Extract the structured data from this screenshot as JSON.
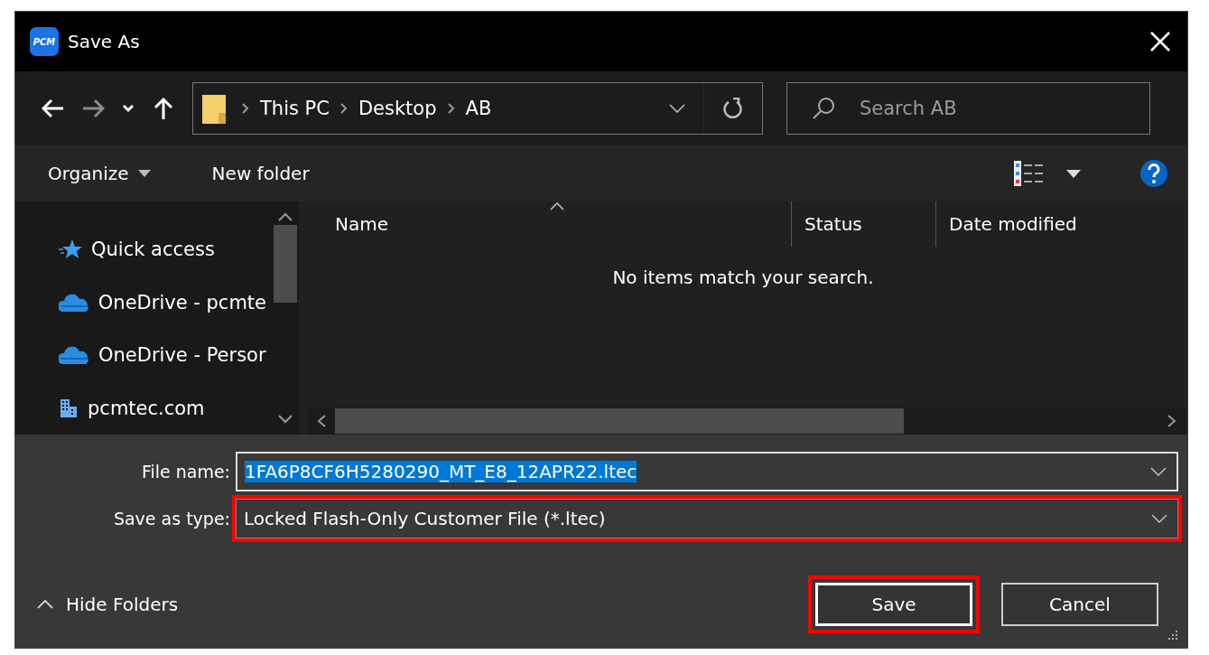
{
  "window": {
    "title": "Save As",
    "app_icon_label": "PCM"
  },
  "nav_buttons": [
    {
      "kind": "back",
      "disabled": false
    },
    {
      "kind": "forward",
      "disabled": true
    },
    {
      "kind": "recent",
      "disabled": false
    },
    {
      "kind": "up",
      "disabled": false
    }
  ],
  "address": {
    "segments": [
      "This PC",
      "Desktop",
      "AB"
    ]
  },
  "search": {
    "placeholder": "Search AB"
  },
  "toolbar": {
    "organize": "Organize",
    "new_folder": "New folder"
  },
  "sidebar": {
    "items": [
      {
        "label": "Quick access",
        "kind": "star"
      },
      {
        "label": "OneDrive - pcmte",
        "kind": "cloud"
      },
      {
        "label": "OneDrive - Persor",
        "kind": "cloud"
      },
      {
        "label": "pcmtec.com",
        "kind": "building"
      }
    ]
  },
  "file_list": {
    "columns": [
      {
        "label": "Name",
        "sorted": true
      },
      {
        "label": "Status",
        "sorted": false
      },
      {
        "label": "Date modified",
        "sorted": false
      }
    ],
    "empty_message": "No items match your search."
  },
  "form": {
    "file_name": {
      "label": "File name:",
      "value": "1FA6P8CF6H5280290_MT_E8_12APR22.ltec",
      "text_selected": true,
      "highlighted": false
    },
    "save_type": {
      "label": "Save as type:",
      "value": "Locked Flash-Only Customer File (*.ltec)",
      "text_selected": false,
      "highlighted": true
    }
  },
  "footer": {
    "hide_folders": "Hide Folders"
  },
  "buttons": [
    {
      "label": "Save",
      "default": true,
      "highlighted": true
    },
    {
      "label": "Cancel",
      "default": false,
      "highlighted": false
    }
  ]
}
